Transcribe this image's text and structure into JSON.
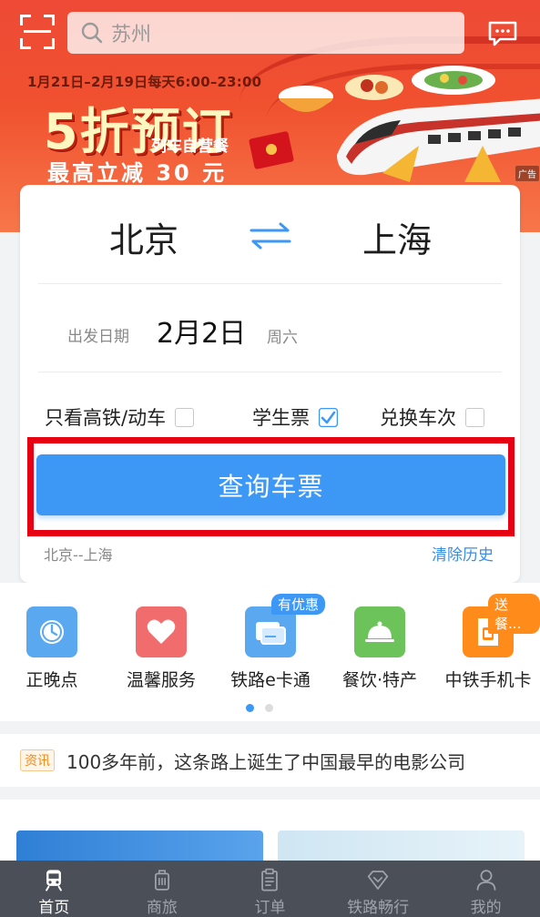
{
  "header": {
    "search_placeholder": "苏州"
  },
  "promo": {
    "date_range": "1月21日–2月19日每天6:00–23:00",
    "main": "5折预订",
    "sub": "列车自营餐",
    "save": "最高立减 30 元",
    "ad_tag": "广告"
  },
  "booking": {
    "from_city": "北京",
    "to_city": "上海",
    "date_label": "出发日期",
    "date_value": "2月2日",
    "date_week": "周六",
    "options": [
      {
        "label": "只看高铁/动车",
        "checked": false
      },
      {
        "label": "学生票",
        "checked": true
      },
      {
        "label": "兑换车次",
        "checked": false
      }
    ],
    "query_button": "查询车票",
    "history": "北京--上海",
    "clear_history": "清除历史"
  },
  "entries": [
    {
      "label": "正晚点",
      "icon": "clock-icon",
      "color": "#5aa8f0"
    },
    {
      "label": "温馨服务",
      "icon": "heart-icon",
      "color": "#f16d6d"
    },
    {
      "label": "铁路e卡通",
      "icon": "card-icon",
      "color": "#5aa8f0",
      "badge": "有优惠"
    },
    {
      "label": "餐饮·特产",
      "icon": "food-cloche-icon",
      "color": "#6cc35a"
    },
    {
      "label": "中铁手机卡",
      "icon": "sim-card-icon",
      "color": "#ff8c1a",
      "badge": "送餐..."
    }
  ],
  "news": {
    "tag": "资讯",
    "text": "100多年前，这条路上诞生了中国最早的电影公司"
  },
  "tabbar": [
    {
      "label": "首页",
      "icon": "train-icon",
      "active": true
    },
    {
      "label": "商旅",
      "icon": "luggage-icon",
      "active": false
    },
    {
      "label": "订单",
      "icon": "clipboard-icon",
      "active": false
    },
    {
      "label": "铁路畅行",
      "icon": "diamond-icon",
      "active": false
    },
    {
      "label": "我的",
      "icon": "user-icon",
      "active": false
    }
  ],
  "colors": {
    "accent": "#3d98f5",
    "banner_red": "#ee4a36",
    "highlight_frame": "#e60012"
  }
}
